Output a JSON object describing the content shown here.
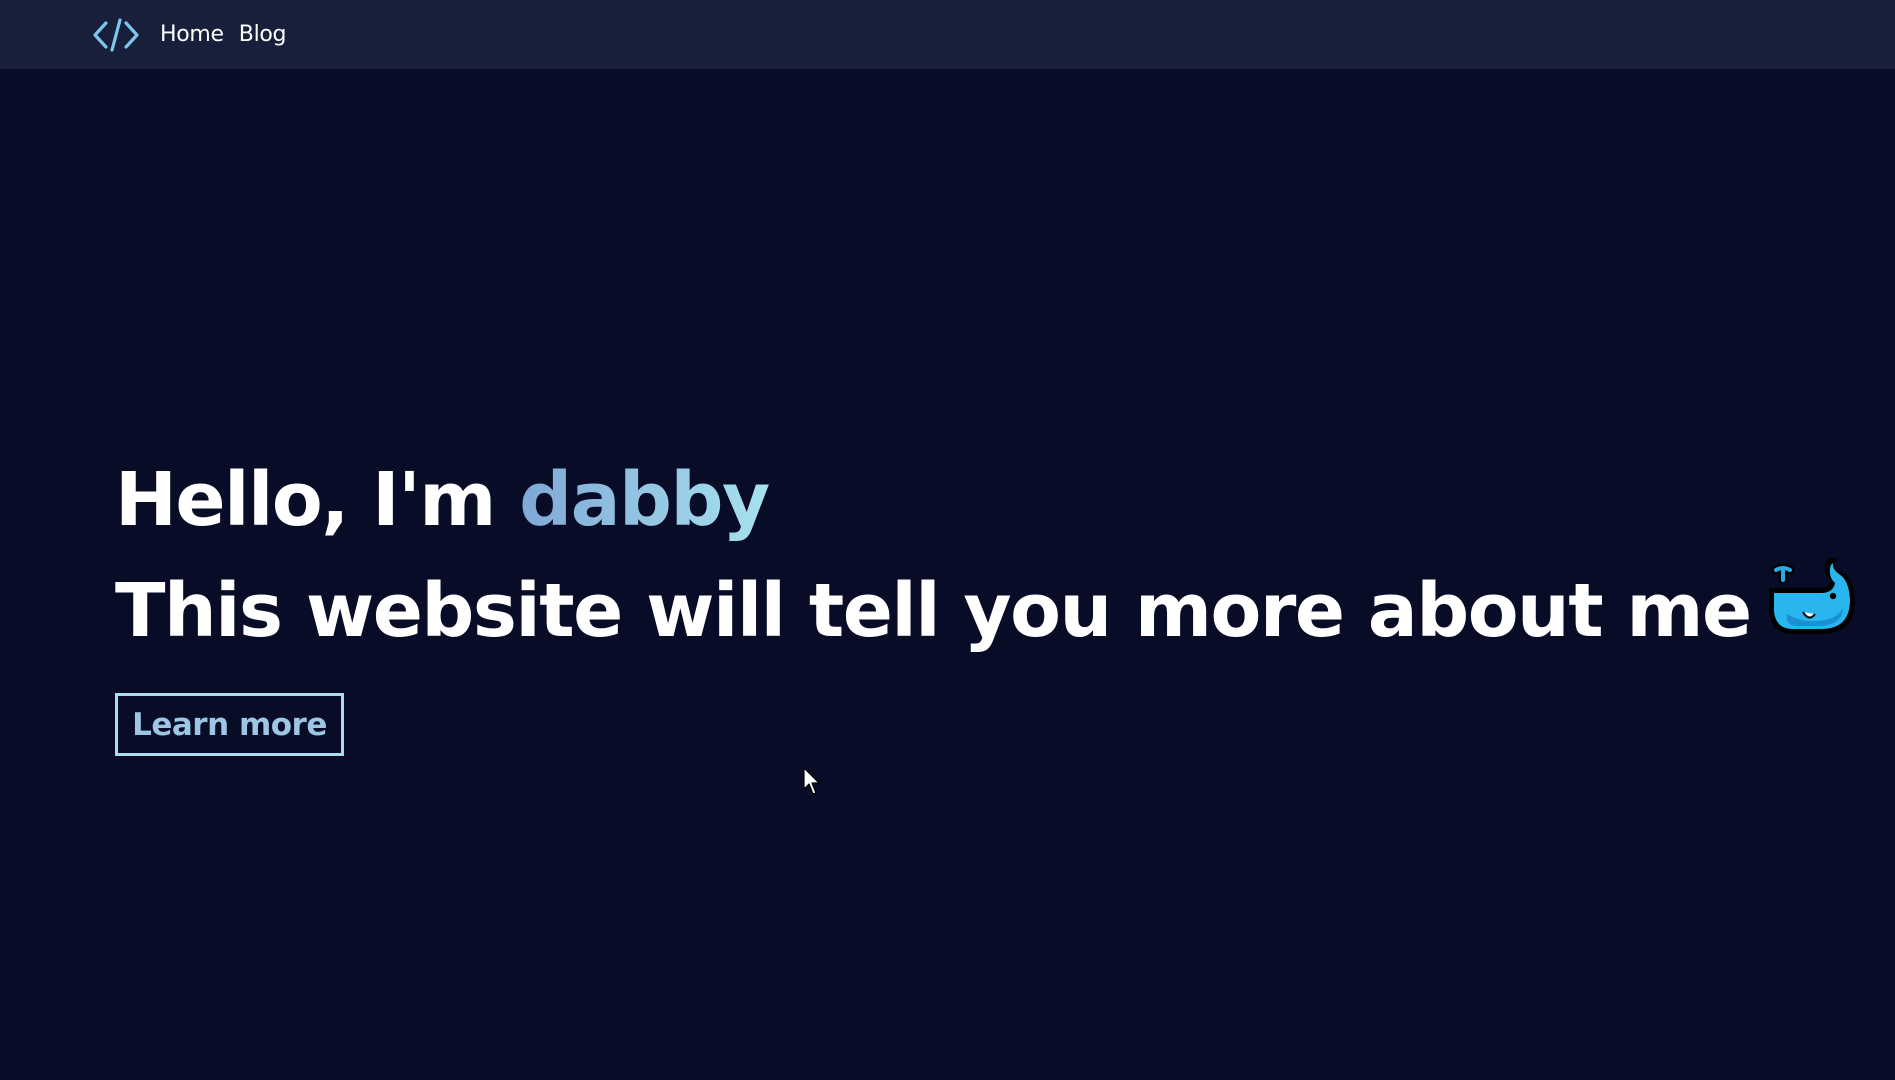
{
  "nav": {
    "logo_icon": "code-brackets-icon",
    "links": [
      {
        "label": "Home"
      },
      {
        "label": "Blog"
      }
    ]
  },
  "hero": {
    "greeting_prefix": "Hello, I'm ",
    "name": "dabby",
    "tagline": "This website will tell you more about me",
    "emoji_icon": "whale-emoji-icon"
  },
  "cta": {
    "label": "Learn more"
  },
  "colors": {
    "background": "#080c26",
    "navbar": "#171f3a",
    "accent_start": "#7fa8d6",
    "accent_end": "#a8e2ef",
    "logo": "#7cc8ec",
    "button_border": "#a9dcef"
  }
}
